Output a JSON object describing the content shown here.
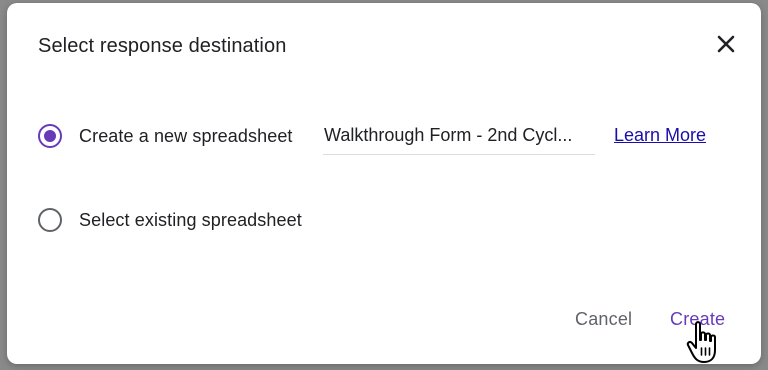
{
  "dialog": {
    "title": "Select response destination",
    "close_icon": "close-icon",
    "options": [
      {
        "label": "Create a new spreadsheet",
        "checked": true
      },
      {
        "label": "Select existing spreadsheet",
        "checked": false
      }
    ],
    "spreadsheet_name": "Walkthrough Form - 2nd Cycl...",
    "learn_more": "Learn More",
    "cancel_label": "Cancel",
    "create_label": "Create"
  },
  "colors": {
    "accent": "#673ab7",
    "link": "#1a0dab",
    "text": "#202124",
    "muted": "#5f6368"
  },
  "cursor_icon": "hand-pointer-icon"
}
